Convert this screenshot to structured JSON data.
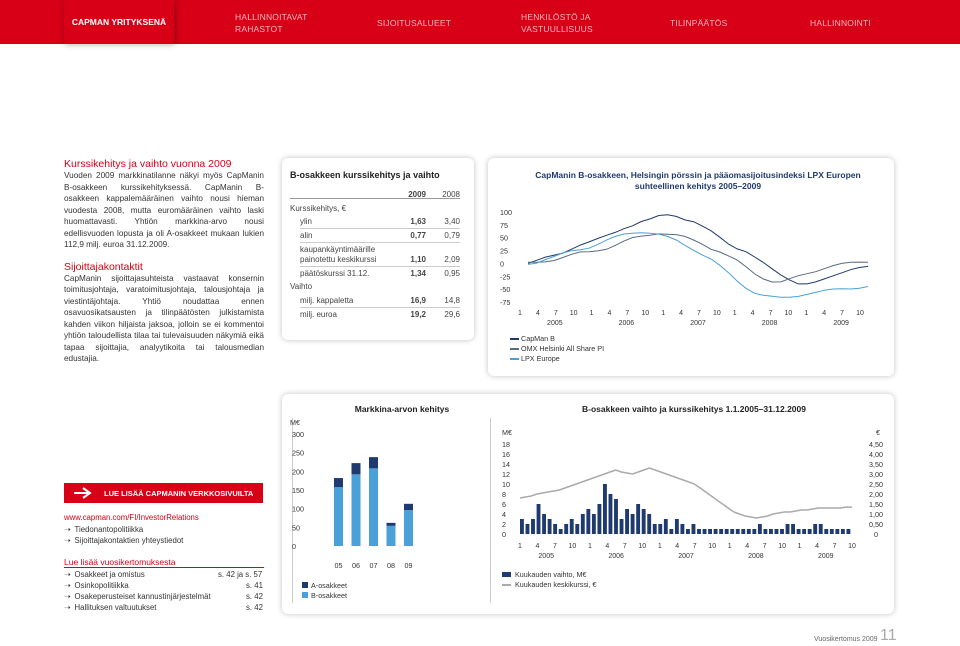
{
  "nav": {
    "active": "CAPMAN YRITYKSENÄ",
    "items": [
      "HALLINNOITAVAT\nRAHASTOT",
      "SIJOITUSALUEET",
      "HENKILÖSTÖ JA\nVASTUULLISUUS",
      "TILINPÄÄTÖS",
      "HALLINNOINTI"
    ]
  },
  "left": {
    "title1": "Kurssikehitys ja vaihto vuonna 2009",
    "text1": "Vuoden 2009 markkinatilanne näkyi myös CapManin B-osakkeen kurssikehityksessä. CapManin B-osakkeen kappalemääräinen vaihto nousi hieman vuodesta 2008, mutta euromääräinen vaihto laski huomattavasti. Yhtiön markkina-arvo nousi edellisvuoden lopusta ja oli A-osakkeet mukaan lukien 112,9 milj. euroa 31.12.2009.",
    "title2": "Sijoittajakontaktit",
    "text2": "CapManin sijoittajasuhteista vastaavat konsernin toimitusjohtaja, varatoimitusjohtaja, talousjohtaja ja viestintäjohtaja. Yhtiö noudattaa ennen osavuosikatsausten ja tilinpäätösten julkistamista kahden viikon hiljaista jaksoa, jolloin se ei kommentoi yhtiön taloudellista tilaa tai tulevaisuuden näkymiä eikä tapaa sijoittajia, analyytikoita tai talousmedian edustajia."
  },
  "table": {
    "title": "B-osakkeen kurssikehitys ja vaihto",
    "col1": "2009",
    "col2": "2008",
    "section1": "Kurssikehitys, €",
    "rows": [
      {
        "label": "ylin",
        "v1": "1,63",
        "v2": "3,40"
      },
      {
        "label": "alin",
        "v1": "0,77",
        "v2": "0,79"
      },
      {
        "label": "kaupankäyntimäärille painotettu keskikurssi",
        "v1": "1,10",
        "v2": "2,09"
      },
      {
        "label": "päätöskurssi 31.12.",
        "v1": "1,34",
        "v2": "0,95"
      }
    ],
    "section2": "Vaihto",
    "rows2": [
      {
        "label": "milj. kappaletta",
        "v1": "16,9",
        "v2": "14,8"
      },
      {
        "label": "milj. euroa",
        "v1": "19,2",
        "v2": "29,6"
      }
    ]
  },
  "linechart": {
    "title": "CapManin B-osakkeen, Helsingin pörssin ja pääomasijoitusindeksi LPX Europen suhteellinen kehitys 2005–2009",
    "legend": [
      "CapMan B",
      "OMX Helsinki All Share PI",
      "LPX Europe"
    ]
  },
  "market": {
    "title": "Markkina-arvon kehitys",
    "unit": "M€",
    "legend": [
      "A-osakkeet",
      "B-osakkeet"
    ]
  },
  "turnover": {
    "title": "B-osakkeen vaihto ja kurssikehitys 1.1.2005–31.12.2009",
    "unit_left": "M€",
    "unit_right": "€",
    "legend": [
      "Kuukauden vaihto, M€",
      "Kuukauden keskikurssi, €"
    ]
  },
  "links": {
    "button": "LUE LISÄÄ CAPMANIN VERKKOSIVUILTA",
    "url": "www.capman.com/FI/InvestorRelations",
    "items": [
      "Tiedonantopolitiikka",
      "Sijoittajakontaktien yhteystiedot"
    ],
    "title2": "Lue lisää vuosikertomuksesta",
    "refs": [
      {
        "label": "Osakkeet ja omistus",
        "page": "s. 42 ja s. 57"
      },
      {
        "label": "Osinkopolitiikka",
        "page": "s. 41"
      },
      {
        "label": "Osakeperusteiset kannustinjärjestelmät",
        "page": "s. 42"
      },
      {
        "label": "Hallituksen valtuutukset",
        "page": "s. 42"
      }
    ]
  },
  "footer": {
    "text": "Vuosikertomus 2009",
    "page": "11"
  },
  "chart_data": [
    {
      "type": "line",
      "title": "CapManin B-osakkeen, Helsingin pörssin ja pääomasijoitusindeksi LPX Europen suhteellinen kehitys 2005–2009",
      "ylim": [
        -75,
        100
      ],
      "yticks": [
        "100",
        "75",
        "50",
        "25",
        "0",
        "-25",
        "-50",
        "-75"
      ],
      "xticks": [
        "1",
        "4",
        "7",
        "10",
        "1",
        "4",
        "7",
        "10",
        "1",
        "4",
        "7",
        "10",
        "1",
        "4",
        "7",
        "10",
        "1",
        "4",
        "7",
        "10"
      ],
      "years": [
        "2005",
        "2006",
        "2007",
        "2008",
        "2009"
      ],
      "series": [
        {
          "name": "CapMan B",
          "color": "#1f3a6e",
          "values": [
            0,
            4,
            10,
            16,
            22,
            30,
            36,
            40,
            46,
            54,
            62,
            70,
            74,
            80,
            84,
            92,
            96,
            94,
            86,
            80,
            70,
            62,
            52,
            40,
            30,
            22,
            10,
            0,
            -10,
            -20,
            -30,
            -40,
            -42,
            -38,
            -30,
            -22,
            -16,
            -12,
            -10,
            -8
          ]
        },
        {
          "name": "OMX Helsinki All Share PI",
          "color": "#5a6a80",
          "values": [
            0,
            2,
            5,
            8,
            12,
            16,
            20,
            22,
            26,
            30,
            36,
            42,
            48,
            52,
            56,
            60,
            58,
            55,
            50,
            44,
            38,
            30,
            24,
            14,
            4,
            -8,
            -20,
            -28,
            -34,
            -36,
            -32,
            -26,
            -20,
            -14,
            -8,
            -4,
            -2,
            0,
            2,
            4
          ]
        },
        {
          "name": "LPX Europe",
          "color": "#4aa0d8",
          "values": [
            0,
            3,
            8,
            12,
            18,
            24,
            28,
            32,
            38,
            44,
            50,
            56,
            60,
            62,
            60,
            56,
            50,
            44,
            36,
            28,
            18,
            8,
            -6,
            -20,
            -34,
            -46,
            -56,
            -62,
            -66,
            -68,
            -66,
            -62,
            -58,
            -56,
            -54,
            -52,
            -50,
            -48,
            -46,
            -44
          ]
        }
      ]
    },
    {
      "type": "bar",
      "title": "Markkina-arvon kehitys",
      "ylabel": "M€",
      "ylim": [
        0,
        300
      ],
      "yticks": [
        "300",
        "250",
        "200",
        "150",
        "100",
        "50",
        "0"
      ],
      "categories": [
        "05",
        "06",
        "07",
        "08",
        "09"
      ],
      "series": [
        {
          "name": "A-osakkeet",
          "color": "#1f3a6e",
          "values": [
            24,
            30,
            30,
            8,
            17
          ]
        },
        {
          "name": "B-osakkeet",
          "color": "#4aa0d8",
          "values": [
            158,
            192,
            208,
            54,
            96
          ]
        }
      ]
    },
    {
      "type": "bar",
      "title": "B-osakkeen vaihto ja kurssikehitys 1.1.2005–31.12.2009",
      "ylim": [
        0,
        18
      ],
      "yticks_left": [
        "18",
        "16",
        "14",
        "12",
        "10",
        "8",
        "6",
        "4",
        "2",
        "0"
      ],
      "yticks_right": [
        "4,50",
        "4,00",
        "3,50",
        "3,00",
        "2,50",
        "2,00",
        "1,50",
        "1,00",
        "0,50",
        "0"
      ],
      "xticks": [
        "1",
        "4",
        "7",
        "10",
        "1",
        "4",
        "7",
        "10",
        "1",
        "4",
        "7",
        "10",
        "1",
        "4",
        "7",
        "10",
        "1",
        "4",
        "7",
        "10"
      ],
      "years": [
        "2005",
        "2006",
        "2007",
        "2008",
        "2009"
      ],
      "series": [
        {
          "name": "Kuukauden vaihto, M€",
          "color": "#1f3a6e",
          "values": [
            3,
            2,
            3,
            6,
            4,
            3,
            2,
            1,
            2,
            3,
            2,
            4,
            5,
            4,
            6,
            10,
            8,
            7,
            3,
            5,
            4,
            6,
            5,
            4,
            2,
            2,
            3,
            1,
            3,
            2,
            1,
            2,
            1,
            1,
            1,
            1,
            1,
            1,
            1,
            1,
            1,
            1,
            1,
            2,
            1,
            1,
            1,
            1,
            2,
            2,
            1,
            1,
            1,
            2,
            2,
            1,
            1,
            1,
            1,
            1
          ]
        },
        {
          "name": "Kuukauden keskikurssi, €",
          "color": "#aaaaaa",
          "values": [
            1.8,
            1.85,
            1.9,
            2.0,
            2.05,
            2.1,
            2.15,
            2.2,
            2.3,
            2.4,
            2.5,
            2.6,
            2.7,
            2.8,
            2.9,
            3.0,
            3.1,
            3.2,
            3.1,
            3.05,
            3.0,
            3.1,
            3.2,
            3.3,
            3.2,
            3.1,
            3.0,
            2.9,
            2.8,
            2.7,
            2.6,
            2.5,
            2.3,
            2.1,
            1.9,
            1.7,
            1.5,
            1.3,
            1.1,
            1.0,
            0.9,
            0.85,
            0.8,
            0.85,
            0.9,
            1.0,
            1.05,
            1.1,
            1.1,
            1.15,
            1.2,
            1.2,
            1.25,
            1.3,
            1.3,
            1.3,
            1.3,
            1.3,
            1.35,
            1.34
          ]
        }
      ]
    }
  ]
}
